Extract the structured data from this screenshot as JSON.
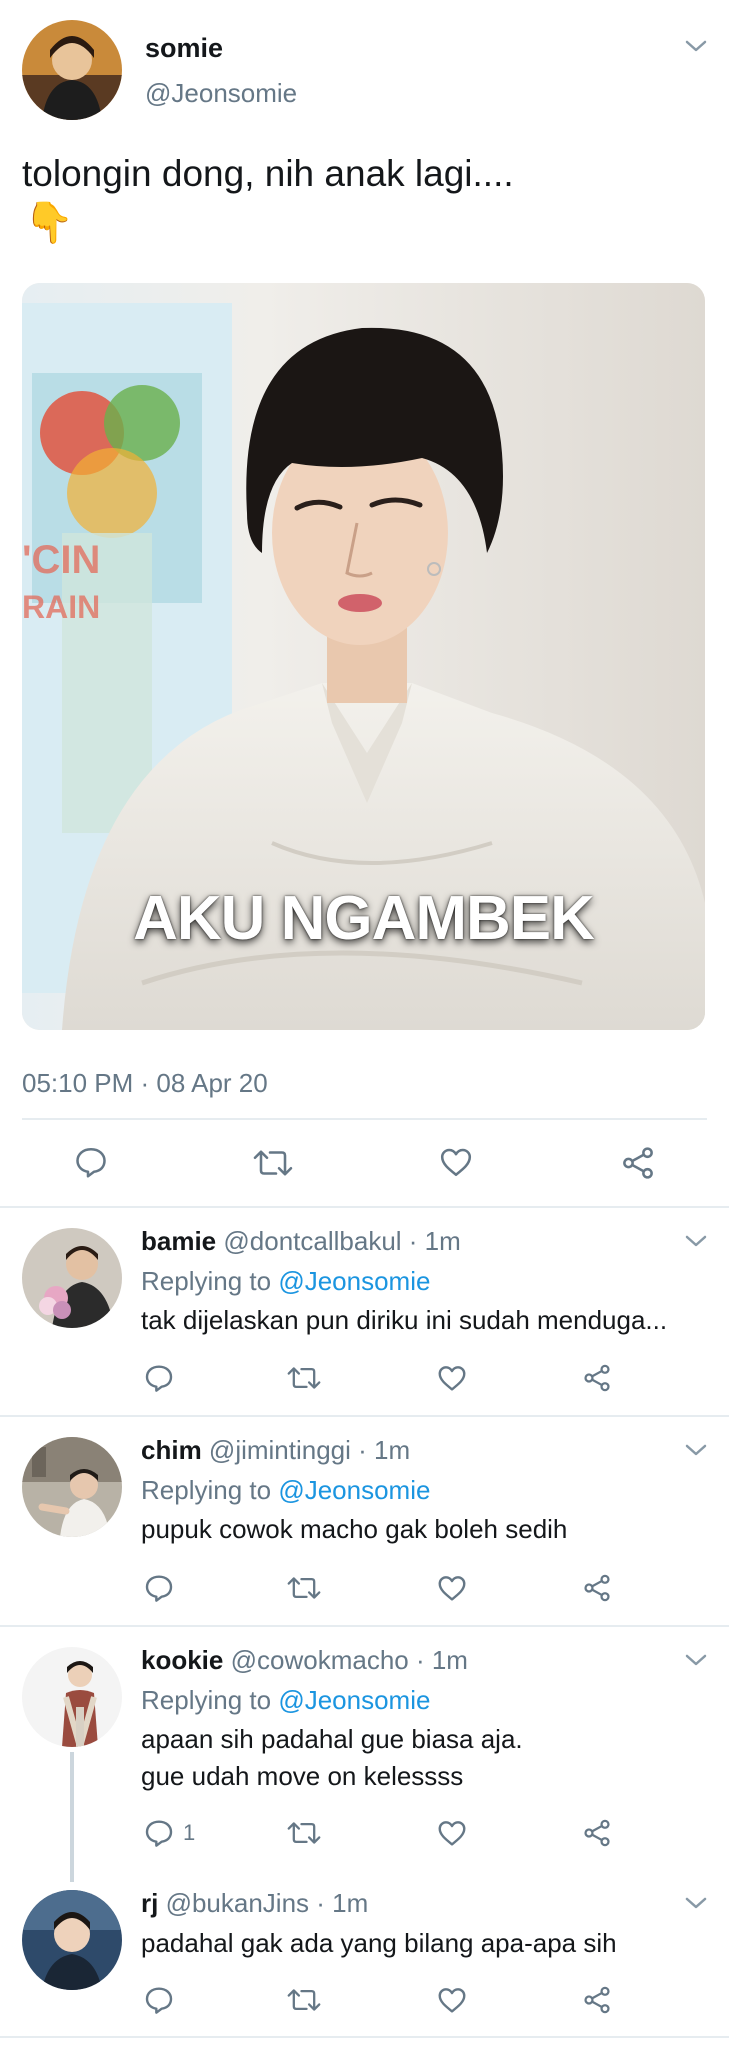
{
  "tweet": {
    "display_name": "somie",
    "handle": "@Jeonsomie",
    "text_line1": "tolongin dong, nih anak lagi....",
    "text_emoji": "👇",
    "image_caption": "AKU NGAMBEK",
    "poster_text": "'CIN\n RAIN",
    "timestamp": "05:10 PM · 08 Apr 20"
  },
  "replies": [
    {
      "display_name": "bamie",
      "meta": "@dontcallbakul · 1m",
      "replying_prefix": "Replying to",
      "replying_to": "@Jeonsomie",
      "text": "tak dijelaskan pun diriku ini sudah menduga..."
    },
    {
      "display_name": "chim",
      "meta": "@jimintinggi · 1m",
      "replying_prefix": "Replying to",
      "replying_to": "@Jeonsomie",
      "text": "pupuk cowok macho gak boleh sedih"
    },
    {
      "display_name": "kookie",
      "meta": "@cowokmacho · 1m",
      "replying_prefix": "Replying to",
      "replying_to": "@Jeonsomie",
      "text_line1": "apaan sih padahal gue biasa aja.",
      "text_line2": "gue udah move on kelessss",
      "reply_count": "1"
    },
    {
      "display_name": "rj",
      "meta": "@bukanJins · 1m",
      "text": "padahal gak ada yang bilang apa-apa sih"
    }
  ],
  "icons": [
    "chevron-down-icon",
    "reply-icon",
    "retweet-icon",
    "like-icon",
    "share-icon"
  ],
  "colors": {
    "link": "#1b95e0",
    "muted": "#657786",
    "divider": "#e6ecf0",
    "text": "#14171a"
  }
}
